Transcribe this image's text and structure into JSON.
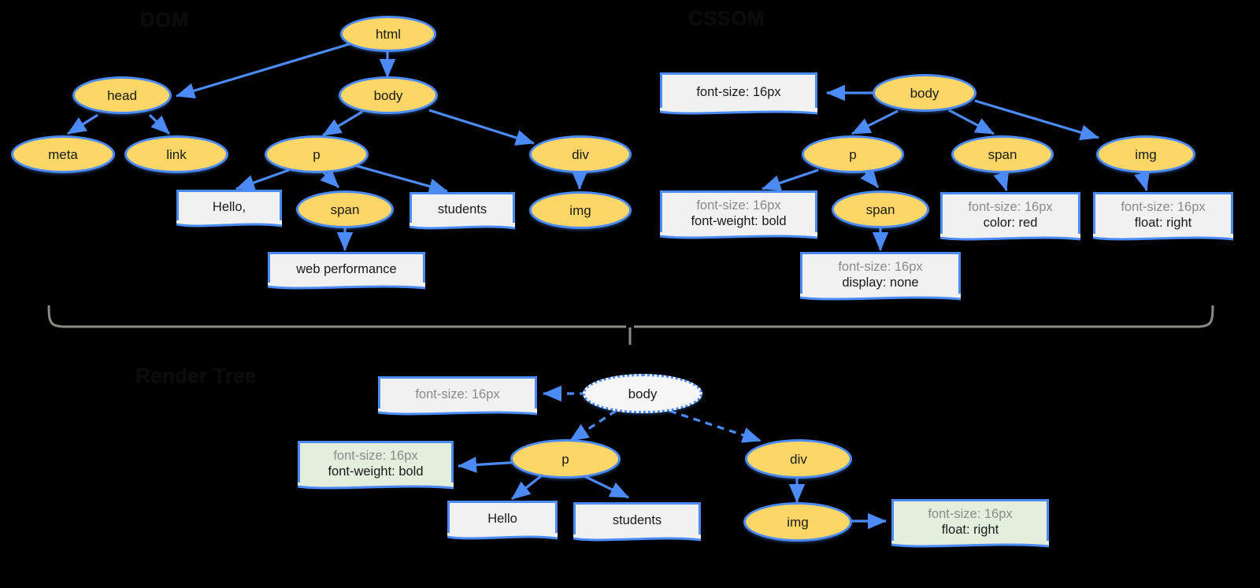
{
  "diagram": {
    "type": "tree-diagram",
    "background_color": "#000000",
    "palette": {
      "node_fill": "#FCD667",
      "node_border": "#4C8BF5",
      "note_fill": "#F1F1F1",
      "note_fill_green": "#E3EEDC",
      "edge_color": "#4C8BF5",
      "brace_color": "#8a8a87",
      "muted_text": "#8a8a8a"
    },
    "sections": [
      {
        "id": "dom",
        "title": "DOM"
      },
      {
        "id": "cssom",
        "title": "CSSOM"
      },
      {
        "id": "render",
        "title": "Render Tree"
      }
    ]
  },
  "dom": {
    "title": "DOM",
    "nodes": [
      {
        "id": "html",
        "label": "html"
      },
      {
        "id": "head",
        "label": "head"
      },
      {
        "id": "body",
        "label": "body"
      },
      {
        "id": "meta",
        "label": "meta"
      },
      {
        "id": "link",
        "label": "link"
      },
      {
        "id": "p",
        "label": "p"
      },
      {
        "id": "div",
        "label": "div"
      },
      {
        "id": "span",
        "label": "span"
      },
      {
        "id": "img",
        "label": "img"
      }
    ],
    "text_nodes": [
      {
        "id": "hello",
        "label": "Hello,"
      },
      {
        "id": "students",
        "label": "students"
      },
      {
        "id": "webperf",
        "label": "web performance"
      }
    ],
    "edges": [
      [
        "html",
        "head"
      ],
      [
        "html",
        "body"
      ],
      [
        "head",
        "meta"
      ],
      [
        "head",
        "link"
      ],
      [
        "body",
        "p"
      ],
      [
        "body",
        "div"
      ],
      [
        "p",
        "hello"
      ],
      [
        "p",
        "span"
      ],
      [
        "p",
        "students"
      ],
      [
        "span",
        "webperf"
      ],
      [
        "div",
        "img"
      ]
    ]
  },
  "cssom": {
    "title": "CSSOM",
    "nodes": [
      {
        "id": "body",
        "label": "body"
      },
      {
        "id": "p",
        "label": "p"
      },
      {
        "id": "span_body",
        "label": "span"
      },
      {
        "id": "img",
        "label": "img"
      },
      {
        "id": "span_p",
        "label": "span"
      }
    ],
    "rule_notes": [
      {
        "id": "n_body",
        "lines": [
          {
            "text": "font-size: 16px",
            "style": "strong"
          }
        ]
      },
      {
        "id": "n_p",
        "lines": [
          {
            "text": "font-size: 16px",
            "style": "muted"
          },
          {
            "text": "font-weight: bold",
            "style": "strong"
          }
        ]
      },
      {
        "id": "n_span_p",
        "lines": [
          {
            "text": "font-size: 16px",
            "style": "muted"
          },
          {
            "text": "display: none",
            "style": "strong"
          }
        ]
      },
      {
        "id": "n_span_body",
        "lines": [
          {
            "text": "font-size: 16px",
            "style": "muted"
          },
          {
            "text": "color: red",
            "style": "strong"
          }
        ]
      },
      {
        "id": "n_img",
        "lines": [
          {
            "text": "font-size: 16px",
            "style": "muted"
          },
          {
            "text": "float: right",
            "style": "strong"
          }
        ]
      }
    ],
    "edges": [
      [
        "body",
        "n_body"
      ],
      [
        "body",
        "p"
      ],
      [
        "body",
        "span_body"
      ],
      [
        "body",
        "img"
      ],
      [
        "p",
        "n_p"
      ],
      [
        "p",
        "span_p"
      ],
      [
        "span_p",
        "n_span_p"
      ],
      [
        "span_body",
        "n_span_body"
      ],
      [
        "img",
        "n_img"
      ]
    ]
  },
  "render": {
    "title": "Render Tree",
    "nodes": [
      {
        "id": "body",
        "label": "body",
        "ghost": true
      },
      {
        "id": "p",
        "label": "p",
        "ghost": false
      },
      {
        "id": "div",
        "label": "div",
        "ghost": false
      },
      {
        "id": "img",
        "label": "img",
        "ghost": false
      }
    ],
    "text_nodes": [
      {
        "id": "hello",
        "label": "Hello"
      },
      {
        "id": "students",
        "label": "students"
      }
    ],
    "rule_notes": [
      {
        "id": "n_body",
        "green": false,
        "lines": [
          {
            "text": "font-size: 16px",
            "style": "muted"
          }
        ]
      },
      {
        "id": "n_p",
        "green": true,
        "lines": [
          {
            "text": "font-size: 16px",
            "style": "muted"
          },
          {
            "text": "font-weight: bold",
            "style": "strong"
          }
        ]
      },
      {
        "id": "n_img",
        "green": true,
        "lines": [
          {
            "text": "font-size: 16px",
            "style": "muted"
          },
          {
            "text": "float: right",
            "style": "strong"
          }
        ]
      }
    ],
    "edges": [
      [
        "body",
        "n_body",
        "dashed"
      ],
      [
        "body",
        "p",
        "dashed"
      ],
      [
        "body",
        "div",
        "dashed"
      ],
      [
        "p",
        "n_p",
        "solid"
      ],
      [
        "p",
        "hello",
        "solid"
      ],
      [
        "p",
        "students",
        "solid"
      ],
      [
        "div",
        "img",
        "solid"
      ],
      [
        "img",
        "n_img",
        "solid"
      ]
    ]
  }
}
